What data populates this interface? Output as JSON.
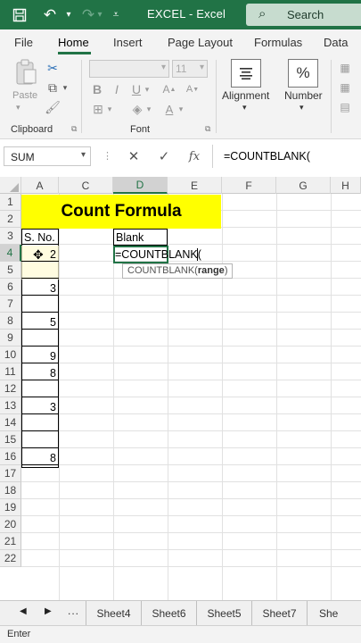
{
  "titlebar": {
    "app_title": "EXCEL - Excel",
    "search_placeholder": "Search"
  },
  "ribbon_tabs": [
    "File",
    "Home",
    "Insert",
    "Page Layout",
    "Formulas",
    "Data"
  ],
  "ribbon": {
    "paste_label": "Paste",
    "clipboard_label": "Clipboard",
    "font_label": "Font",
    "font_size": "11",
    "alignment_label": "Alignment",
    "number_label": "Number",
    "percent_symbol": "%"
  },
  "formula_bar": {
    "name_box": "SUM",
    "fx_label": "fx",
    "formula": "=COUNTBLANK("
  },
  "columns": [
    "A",
    "C",
    "D",
    "E",
    "F",
    "G",
    "H"
  ],
  "rows": [
    "1",
    "2",
    "3",
    "4",
    "5",
    "6",
    "7",
    "8",
    "9",
    "10",
    "11",
    "12",
    "13",
    "14",
    "15",
    "16",
    "17",
    "18",
    "19",
    "20",
    "21",
    "22"
  ],
  "sheet": {
    "title": "Count Formula",
    "header_sno": "S. No.",
    "header_blank": "Blank",
    "values": {
      "r4": "2",
      "r6": "3",
      "r8": "5",
      "r10": "9",
      "r11": "8",
      "r13": "3",
      "r16": "8"
    },
    "active_cell_text": "=COUNTBLANK(",
    "tooltip_func": "COUNTBLANK(",
    "tooltip_arg": "range",
    "tooltip_close": ")"
  },
  "sheet_tabs": [
    "Sheet4",
    "Sheet6",
    "Sheet5",
    "Sheet7",
    "She"
  ],
  "sheet_dots": "...",
  "status": "Enter",
  "colors": {
    "excel_green": "#217346",
    "highlight": "#ffff00"
  }
}
